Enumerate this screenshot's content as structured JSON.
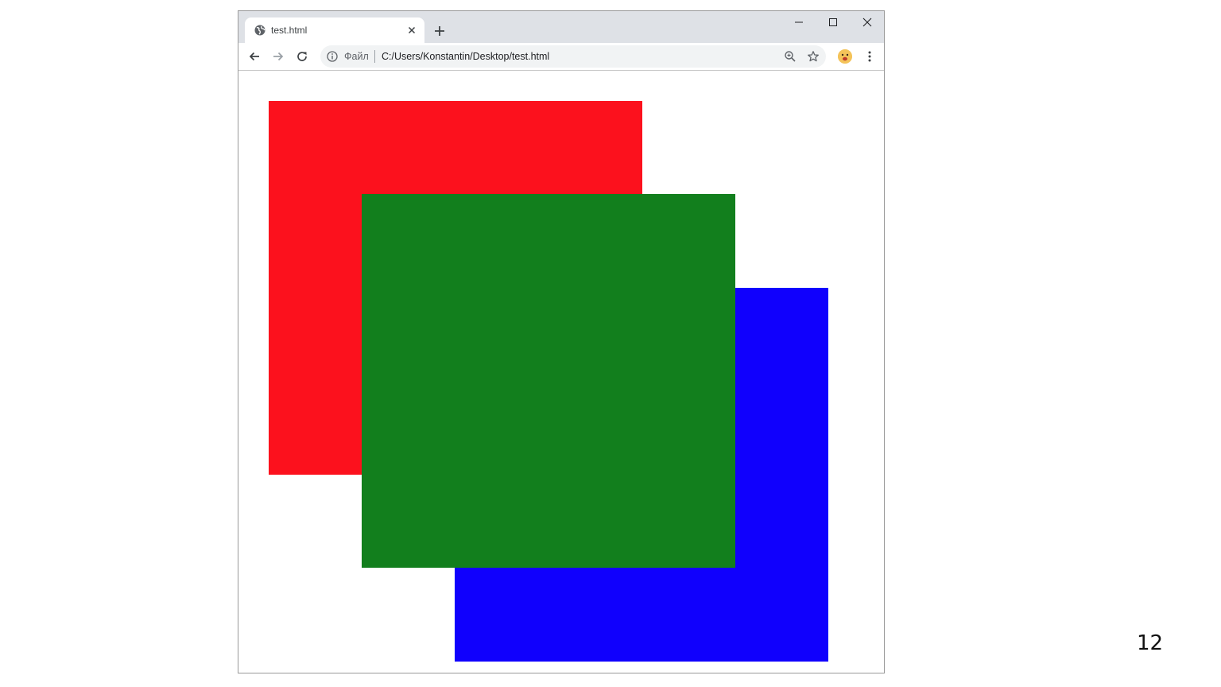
{
  "browser": {
    "tab": {
      "title": "test.html",
      "favicon_icon": "globe-icon",
      "close_icon": "close-icon"
    },
    "new_tab_icon": "plus-icon",
    "window_controls": [
      "minimize-icon",
      "maximize-icon",
      "close-icon"
    ],
    "toolbar": {
      "back_icon": "arrow-left-icon",
      "forward_icon": "arrow-right-icon",
      "reload_icon": "reload-icon",
      "address": {
        "info_icon": "info-icon",
        "scheme_label": "Файл",
        "url": "C:/Users/Konstantin/Desktop/test.html",
        "zoom_icon": "zoom-icon",
        "bookmark_icon": "star-icon"
      },
      "profile_icon": "avatar-icon",
      "menu_icon": "kebab-menu-icon"
    }
  },
  "page": {
    "boxes": [
      {
        "name": "red-square",
        "color": "#fc111d"
      },
      {
        "name": "blue-square",
        "color": "#1000fd"
      },
      {
        "name": "green-square",
        "color": "#127f1d"
      }
    ]
  },
  "slide": {
    "number": "12"
  }
}
